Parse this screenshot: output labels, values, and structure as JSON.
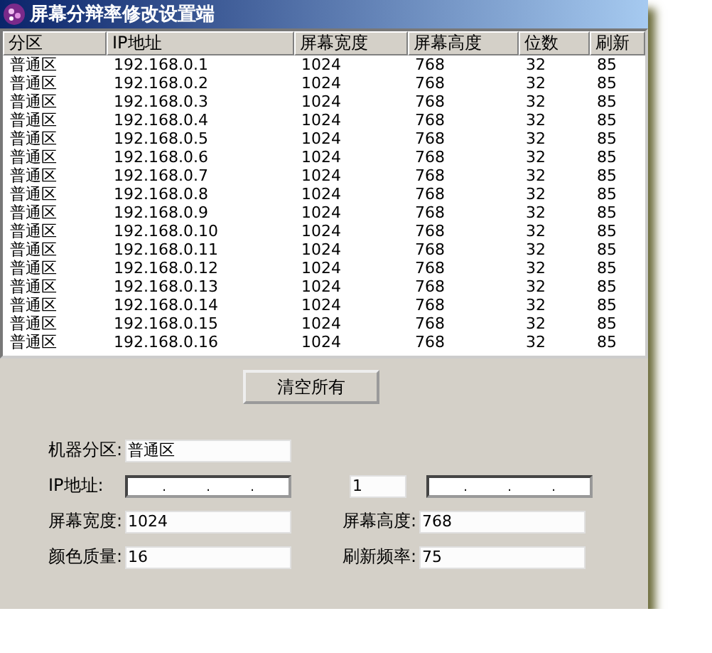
{
  "window": {
    "title": "屏幕分辩率修改设置端"
  },
  "table": {
    "columns": [
      "分区",
      "IP地址",
      "屏幕宽度",
      "屏幕高度",
      "位数",
      "刷新"
    ],
    "rows": [
      [
        "普通区",
        "192.168.0.1",
        "1024",
        "768",
        "32",
        "85"
      ],
      [
        "普通区",
        "192.168.0.2",
        "1024",
        "768",
        "32",
        "85"
      ],
      [
        "普通区",
        "192.168.0.3",
        "1024",
        "768",
        "32",
        "85"
      ],
      [
        "普通区",
        "192.168.0.4",
        "1024",
        "768",
        "32",
        "85"
      ],
      [
        "普通区",
        "192.168.0.5",
        "1024",
        "768",
        "32",
        "85"
      ],
      [
        "普通区",
        "192.168.0.6",
        "1024",
        "768",
        "32",
        "85"
      ],
      [
        "普通区",
        "192.168.0.7",
        "1024",
        "768",
        "32",
        "85"
      ],
      [
        "普通区",
        "192.168.0.8",
        "1024",
        "768",
        "32",
        "85"
      ],
      [
        "普通区",
        "192.168.0.9",
        "1024",
        "768",
        "32",
        "85"
      ],
      [
        "普通区",
        "192.168.0.10",
        "1024",
        "768",
        "32",
        "85"
      ],
      [
        "普通区",
        "192.168.0.11",
        "1024",
        "768",
        "32",
        "85"
      ],
      [
        "普通区",
        "192.168.0.12",
        "1024",
        "768",
        "32",
        "85"
      ],
      [
        "普通区",
        "192.168.0.13",
        "1024",
        "768",
        "32",
        "85"
      ],
      [
        "普通区",
        "192.168.0.14",
        "1024",
        "768",
        "32",
        "85"
      ],
      [
        "普通区",
        "192.168.0.15",
        "1024",
        "768",
        "32",
        "85"
      ],
      [
        "普通区",
        "192.168.0.16",
        "1024",
        "768",
        "32",
        "85"
      ]
    ]
  },
  "clear_button": "清空所有",
  "form": {
    "zone": {
      "label": "机器分区:",
      "value": "普通区"
    },
    "ip": {
      "label": "IP地址:",
      "dots": [
        ".",
        ".",
        "."
      ]
    },
    "ip_count": {
      "value": "1"
    },
    "ip_end": {
      "dots": [
        ".",
        ".",
        "."
      ]
    },
    "width": {
      "label": "屏幕宽度:",
      "value": "1024"
    },
    "height": {
      "label": "屏幕高度:",
      "value": "768"
    },
    "color": {
      "label": "颜色质量:",
      "value": "16"
    },
    "refresh": {
      "label": "刷新频率:",
      "value": "75"
    }
  }
}
